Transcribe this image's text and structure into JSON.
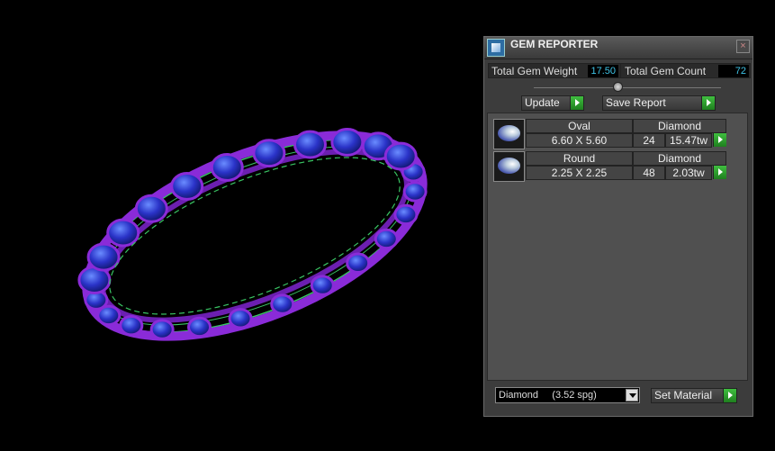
{
  "panel": {
    "title": "GEM REPORTER",
    "close_label": "×",
    "total_gem_weight_label": "Total Gem Weight",
    "total_gem_weight_value": "17.50",
    "total_gem_count_label": "Total Gem Count",
    "total_gem_count_value": "72",
    "update_label": "Update",
    "save_report_label": "Save Report",
    "gems": [
      {
        "shape": "Oval",
        "material": "Diamond",
        "size": "6.60 X 5.60",
        "count": "24",
        "weight": "15.47tw"
      },
      {
        "shape": "Round",
        "material": "Diamond",
        "size": "2.25 X 2.25",
        "count": "48",
        "weight": "2.03tw"
      }
    ],
    "material_select_value": "Diamond     (3.52 spg)",
    "set_material_label": "Set Material"
  },
  "colors": {
    "stone_blue": "#2a33c8",
    "prong_purple": "#8a2bd8",
    "wire_green": "#39c463",
    "value_cyan": "#3ec3e6",
    "button_green": "#2fa52f"
  }
}
